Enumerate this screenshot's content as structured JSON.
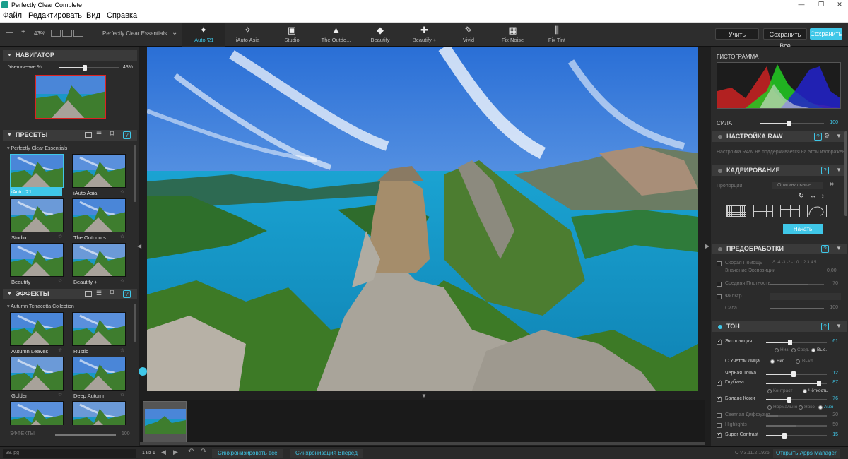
{
  "window": {
    "title": "Perfectly Clear Complete"
  },
  "menu": [
    "Файл",
    "Редактировать",
    "Вид",
    "Справка"
  ],
  "toolbar": {
    "zoom": "43%",
    "preset_group": "Perfectly Clear Essentials",
    "tools": [
      {
        "label": "iAuto '21",
        "icon": "magic-wand-icon",
        "glyph": "✦"
      },
      {
        "label": "iAuto Asia",
        "icon": "magic-wand-icon",
        "glyph": "✧"
      },
      {
        "label": "Studio",
        "icon": "portrait-icon",
        "glyph": "▣"
      },
      {
        "label": "The Outdo...",
        "icon": "landscape-icon",
        "glyph": "▲"
      },
      {
        "label": "Beautify",
        "icon": "face-icon",
        "glyph": "◆"
      },
      {
        "label": "Beautify +",
        "icon": "face-plus-icon",
        "glyph": "✚"
      },
      {
        "label": "Vivid",
        "icon": "brush-icon",
        "glyph": "✎"
      },
      {
        "label": "Fix Noise",
        "icon": "noise-icon",
        "glyph": "▦"
      },
      {
        "label": "Fix Tint",
        "icon": "thermometer-icon",
        "glyph": "⫼"
      }
    ],
    "learn": "Учить",
    "save_all": "Сохранить Все",
    "save": "Сохранить"
  },
  "navigator": {
    "title": "НАВИГАТОР",
    "zoom_label": "Увеличение %",
    "zoom_value": "43%",
    "zoom_fraction": 0.43
  },
  "presets": {
    "title": "ПРЕСЕТЫ",
    "group": "Perfectly Clear Essentials",
    "items": [
      "iAuto '21",
      "iAuto Asia",
      "Studio",
      "The Outdoors",
      "Beautify",
      "Beautify +"
    ]
  },
  "effects": {
    "title": "ЭФФЕКТЫ",
    "group": "Autumn Terracotta Collection",
    "items": [
      "Autumn Leaves",
      "Rustic",
      "Golden",
      "Deep Autumn",
      "",
      ""
    ],
    "footer_label": "ЭФФЕКТЫ",
    "footer_value": "100",
    "footer_fraction": 1.0
  },
  "histogram": {
    "title": "ГИСТОГРАММА",
    "strength_label": "СИЛА",
    "strength_value": "100",
    "strength_fraction": 0.45
  },
  "raw": {
    "title": "НАСТРОЙКА RAW",
    "message": "Настройка RAW не поддерживается на этом изображении"
  },
  "crop": {
    "title": "КАДРИРОВАНИЕ",
    "proportion_label": "Пропорции",
    "proportion_value": "Оригинальные",
    "start": "Начать"
  },
  "preprocess": {
    "title": "ПРЕДОБРАБОТКИ",
    "quick_help": "Скорая Помощь",
    "quick_scale": "-5 -4 -3 -2 -1 0 1 2 3 4 5",
    "exposure_value_label": "Значение Экспозиции",
    "exposure_value": "0,00",
    "density_label": "Средняя Плотность",
    "density_value": "70",
    "density_fraction": 0.7,
    "filter_label": "Фильтр",
    "strength_label": "Сила",
    "strength_value": "100",
    "strength_fraction": 1.0
  },
  "tone": {
    "title": "ТОН",
    "exposure": {
      "label": "Экспозиция",
      "value": "61",
      "fraction": 0.4
    },
    "exposure_modes": [
      "Низ.",
      "Сред.",
      "Выс."
    ],
    "face_label": "С Учетом Лица",
    "face_modes": [
      "Вкл.",
      "Выкл."
    ],
    "black_point": {
      "label": "Черная Точка",
      "value": "12",
      "fraction": 0.45
    },
    "depth": {
      "label": "Глубина",
      "value": "87",
      "fraction": 0.87
    },
    "depth_modes": [
      "Контраст",
      "Чёткость"
    ],
    "skin": {
      "label": "Баланс Кожи",
      "value": "76",
      "fraction": 0.38
    },
    "skin_modes": [
      "Нормально",
      "Ярко",
      "Auto"
    ],
    "diffuse": {
      "label": "Светлая Диффузия",
      "value": "20",
      "fraction": 0.2
    },
    "highlights": {
      "label": "Highlights",
      "value": "50",
      "fraction": 0.5
    },
    "super_contrast": {
      "label": "Super Contrast",
      "value": "15",
      "fraction": 0.3
    }
  },
  "status": {
    "filename": "38.jpg",
    "page": "1 из 1",
    "sync_all": "Синхронизировать все",
    "sync_forward": "Синхронизация Вперёд",
    "version": "О v.3.11.2.1926",
    "apps_manager": "Открыть Apps Manager"
  },
  "colors": {
    "accent": "#3fc7e8",
    "bg": "#2b2b2b",
    "header": "#3a3a3a"
  }
}
